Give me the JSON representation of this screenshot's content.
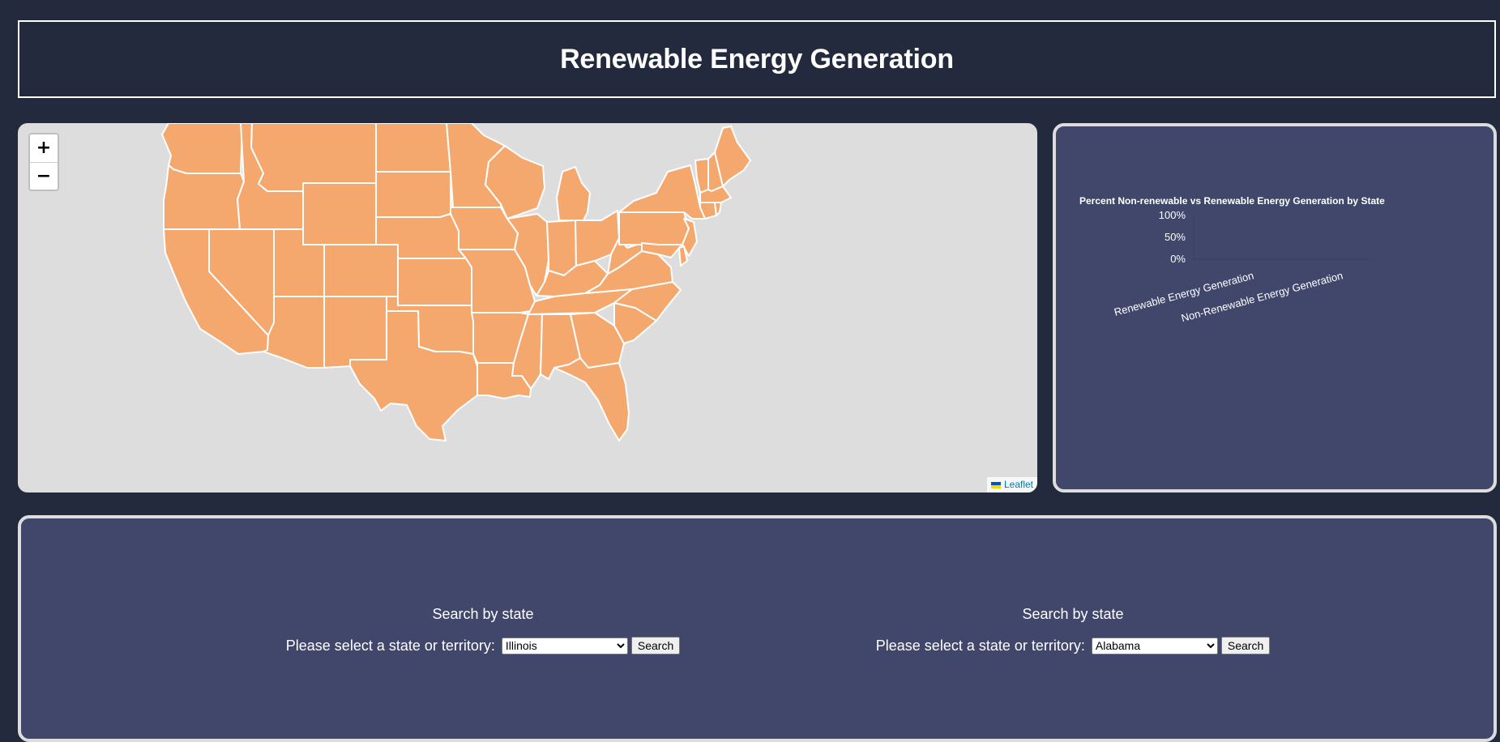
{
  "header": {
    "title": "Renewable Energy Generation"
  },
  "map": {
    "zoom_in_label": "+",
    "zoom_out_label": "−",
    "attribution": "Leaflet",
    "state_fill": "#f4a86e",
    "state_stroke": "#ffffff",
    "background": "#dddddd"
  },
  "chart_data": {
    "type": "bar",
    "title": "Percent Non-renewable vs Renewable Energy Generation by State",
    "categories": [
      "Renewable Energy Generation",
      "Non-Renewable Energy Generation"
    ],
    "values": [],
    "y_ticks": [
      "100%",
      "50%",
      "0%"
    ],
    "ylim": [
      0,
      100
    ]
  },
  "search": [
    {
      "heading": "Search by state",
      "prompt": "Please select a state or territory:",
      "selected": "Illinois",
      "button": "Search"
    },
    {
      "heading": "Search by state",
      "prompt": "Please select a state or territory:",
      "selected": "Alabama",
      "button": "Search"
    }
  ],
  "colors": {
    "page_bg": "#242a3d",
    "panel_bg": "#41476b",
    "panel_border": "#dddddd"
  }
}
